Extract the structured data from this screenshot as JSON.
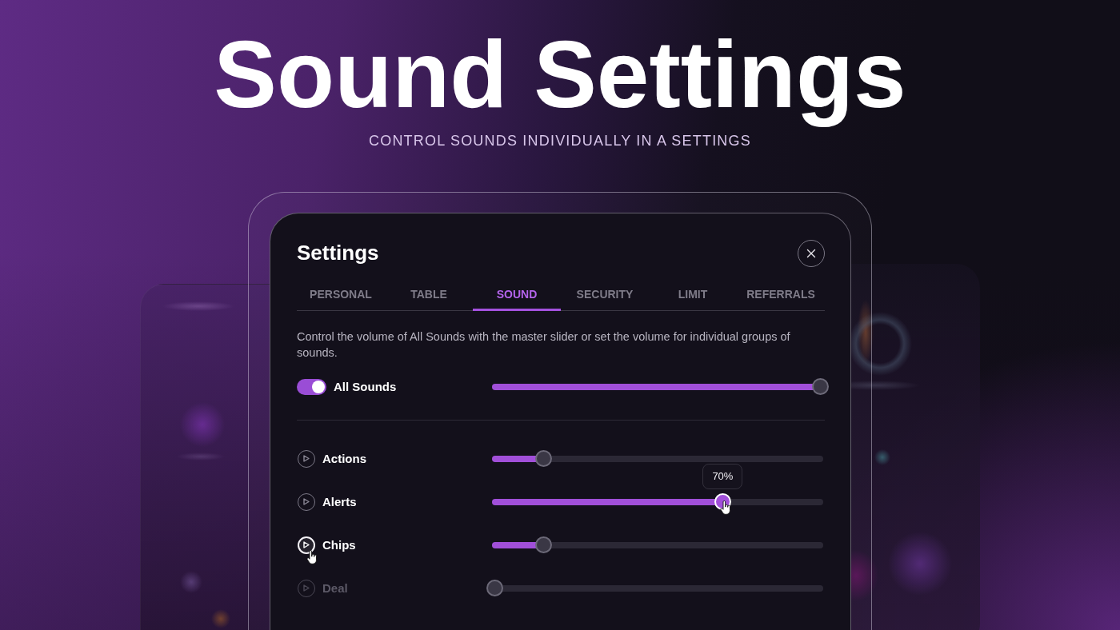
{
  "hero": {
    "title": "Sound Settings",
    "subtitle": "CONTROL SOUNDS INDIVIDUALLY IN A SETTINGS"
  },
  "dialog": {
    "title": "Settings",
    "tabs": [
      {
        "label": "PERSONAL",
        "selected": false
      },
      {
        "label": "TABLE",
        "selected": false
      },
      {
        "label": "SOUND",
        "selected": true
      },
      {
        "label": "SECURITY",
        "selected": false
      },
      {
        "label": "LIMIT",
        "selected": false
      },
      {
        "label": "REFERRALS",
        "selected": false
      }
    ],
    "description": "Control the volume of All Sounds with the master slider or set the volume for individual groups of sounds.",
    "master": {
      "label": "All Sounds",
      "on": true,
      "level": 1
    },
    "channels": [
      {
        "name": "Actions",
        "level": 0.15,
        "disabled": false,
        "play_hovered": false,
        "dragging": false
      },
      {
        "name": "Alerts",
        "level": 0.7,
        "disabled": false,
        "play_hovered": false,
        "dragging": true,
        "tooltip": "70%"
      },
      {
        "name": "Chips",
        "level": 0.15,
        "disabled": false,
        "play_hovered": true,
        "dragging": false
      },
      {
        "name": "Deal",
        "level": 0,
        "disabled": true,
        "play_hovered": false,
        "dragging": false
      }
    ]
  }
}
